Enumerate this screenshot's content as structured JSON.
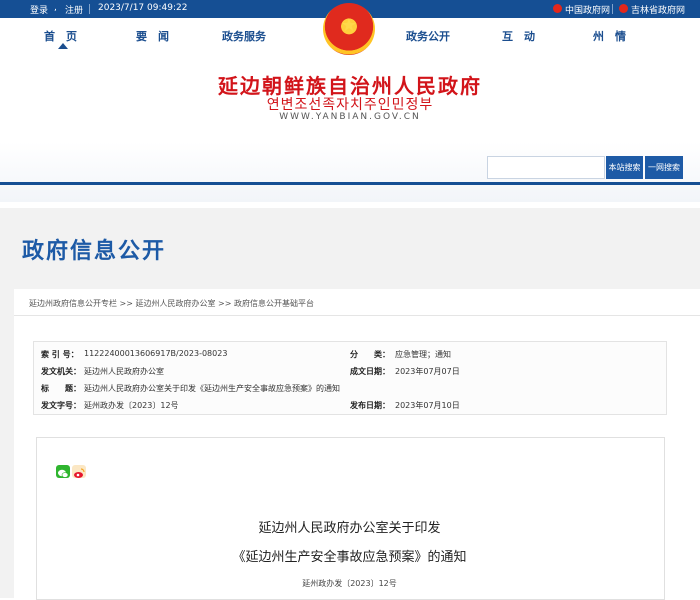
{
  "topbar": {
    "login": "登录",
    "register": "注册",
    "datetime": "2023/7/17 09:49:22",
    "link_china_gov": "中国政府网",
    "link_jilin_gov": "吉林省政府网"
  },
  "nav": {
    "home": "首　页",
    "news": "要　闻",
    "services": "政务服务",
    "disclosure": "政务公开",
    "interaction": "互　动",
    "prefecture": "州　情"
  },
  "banner": {
    "title_cn": "延边朝鲜族自治州人民政府",
    "title_kr": "연변조선족자치주인민정부",
    "url": "WWW.YANBIAN.GOV.CN",
    "search_site_button": "本站搜索",
    "search_all_button": "一网搜索"
  },
  "section_title": "政府信息公开",
  "breadcrumb": "延边州政府信息公开专栏 >> 延边州人民政府办公室 >> 政府信息公开基础平台",
  "meta": {
    "index_label": "索 引 号：",
    "index_value": "11222400013606917B/2023-08023",
    "category_label": "分　　类：",
    "category_value": "应急管理；通知",
    "issuer_label": "发文机关：",
    "issuer_value": "延边州人民政府办公室",
    "created_label": "成文日期：",
    "created_value": "2023年07月07日",
    "title_label": "标　　题：",
    "title_value": "延边州人民政府办公室关于印发《延边州生产安全事故应急预案》的通知",
    "docno_label": "发文字号：",
    "docno_value": "延州政办发〔2023〕12号",
    "published_label": "发布日期：",
    "published_value": "2023年07月10日"
  },
  "document": {
    "title_line1": "延边州人民政府办公室关于印发",
    "title_line2": "《延边州生产安全事故应急预案》的通知",
    "doc_number": "延州政办发〔2023〕12号"
  },
  "colors": {
    "brand_blue": "#154f94",
    "title_red": "#d2141a"
  },
  "icons": [
    "wechat-share-icon",
    "weibo-share-icon",
    "national-emblem-icon"
  ]
}
